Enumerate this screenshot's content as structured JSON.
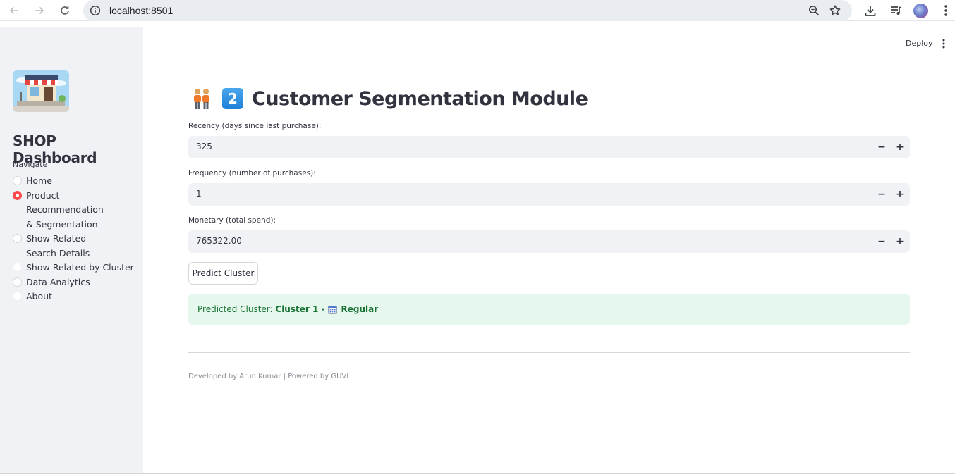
{
  "browser": {
    "url": "localhost:8501",
    "icons": [
      "back-arrow-icon",
      "forward-arrow-icon",
      "reload-icon",
      "info-icon",
      "zoom-icon",
      "star-icon",
      "download-icon",
      "media-control-icon",
      "profile-avatar",
      "kebab-menu-icon"
    ]
  },
  "sidebar": {
    "title": "SHOP Dashboard",
    "nav_label": "Navigate",
    "items": [
      {
        "label": "Home",
        "selected": false
      },
      {
        "label": "Product Recommendation & Segmentation",
        "selected": true
      },
      {
        "label": "Show Related Search Details",
        "selected": false
      },
      {
        "label": "Show Related by Cluster",
        "selected": false
      },
      {
        "label": "Data Analytics",
        "selected": false
      },
      {
        "label": "About",
        "selected": false
      }
    ]
  },
  "toolbar": {
    "deploy_label": "Deploy"
  },
  "main": {
    "badge_number": "2",
    "title": "Customer Segmentation Module",
    "fields": [
      {
        "label": "Recency (days since last purchase):",
        "value": "325"
      },
      {
        "label": "Frequency (number of purchases):",
        "value": "1"
      },
      {
        "label": "Monetary (total spend):",
        "value": "765322.00"
      }
    ],
    "stepper_minus": "−",
    "stepper_plus": "+",
    "predict_button": "Predict Cluster",
    "result": {
      "prefix": "Predicted Cluster: ",
      "cluster": "Cluster 1 -",
      "segment": "Regular"
    },
    "footer": "Developed by Arun Kumar | Powered by GUVI"
  },
  "colors": {
    "accent": "#ff4b4b",
    "sidebar_bg": "#f0f2f6",
    "input_bg": "#f0f2f6",
    "success_bg": "#e6f7ee",
    "success_text": "#177233",
    "badge_blue": "#2b8ae0"
  }
}
